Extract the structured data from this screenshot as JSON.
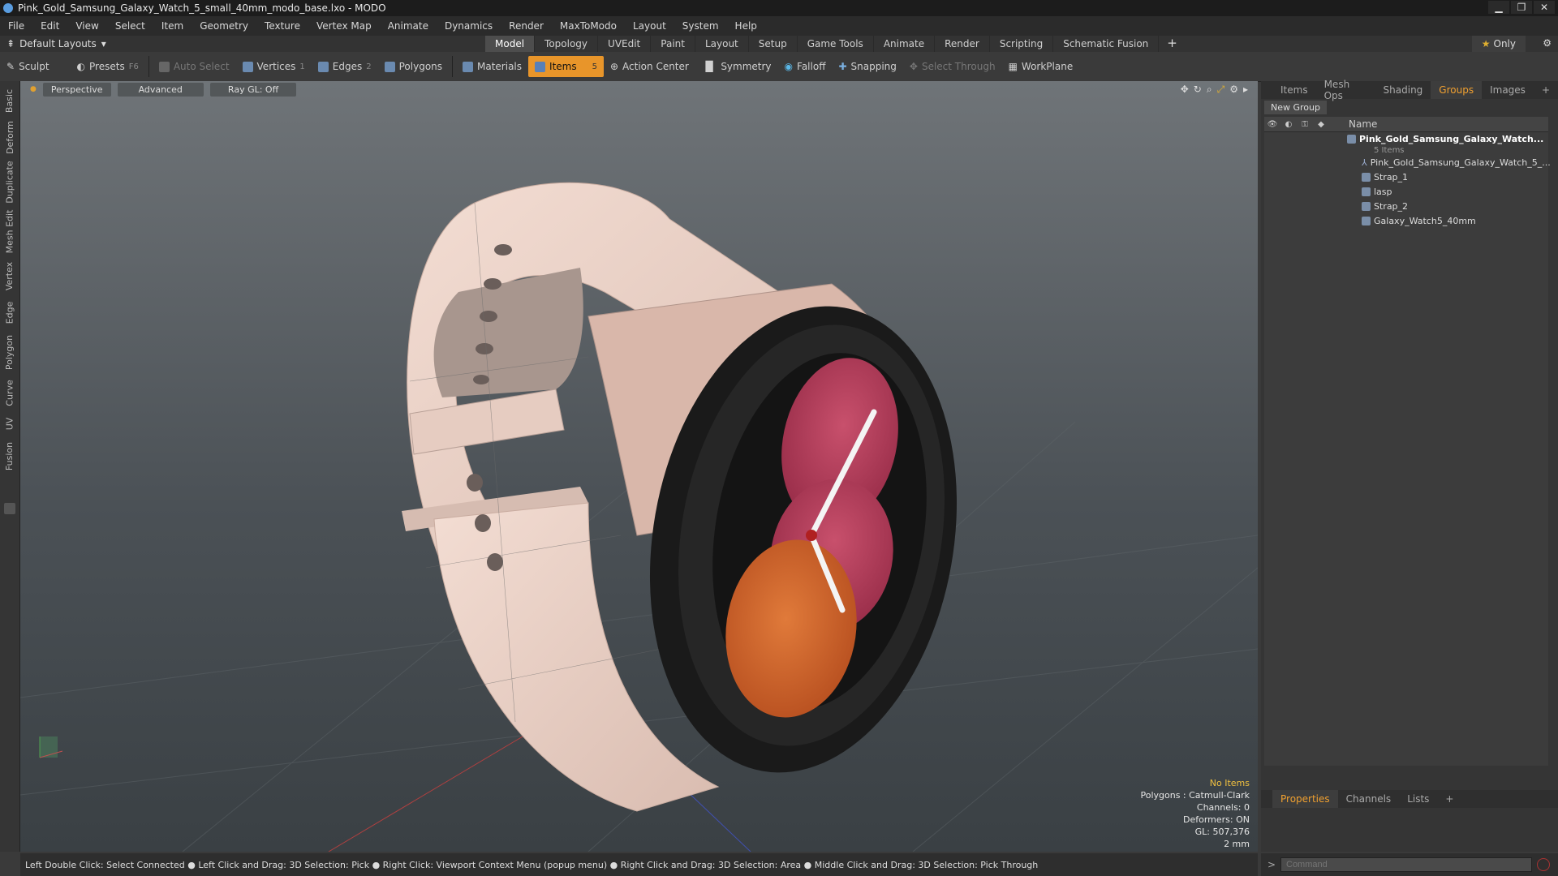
{
  "window": {
    "title": "Pink_Gold_Samsung_Galaxy_Watch_5_small_40mm_modo_base.lxo - MODO"
  },
  "menu": [
    "File",
    "Edit",
    "View",
    "Select",
    "Item",
    "Geometry",
    "Texture",
    "Vertex Map",
    "Animate",
    "Dynamics",
    "Render",
    "MaxToModo",
    "Layout",
    "System",
    "Help"
  ],
  "layout": {
    "dropdown": "Default Layouts",
    "tabs": [
      "Model",
      "Topology",
      "UVEdit",
      "Paint",
      "Layout",
      "Setup",
      "Game Tools",
      "Animate",
      "Render",
      "Scripting",
      "Schematic Fusion"
    ],
    "active_tab": "Model",
    "only_label": "Only"
  },
  "toolbar": {
    "sculpt": "Sculpt",
    "presets": "Presets",
    "presets_key": "F6",
    "auto_select": "Auto Select",
    "vertices": "Vertices",
    "vertices_count": "1",
    "edges": "Edges",
    "edges_count": "2",
    "polygons": "Polygons",
    "materials": "Materials",
    "items": "Items",
    "items_count": "5",
    "action_center": "Action Center",
    "symmetry": "Symmetry",
    "falloff": "Falloff",
    "snapping": "Snapping",
    "select_through": "Select Through",
    "workplane": "WorkPlane"
  },
  "left_tabs": [
    "Basic",
    "Deform",
    "Duplicate",
    "Mesh Edit",
    "Vertex",
    "Edge",
    "Polygon",
    "Curve",
    "UV",
    "Fusion"
  ],
  "viewport": {
    "perspective": "Perspective",
    "advanced": "Advanced",
    "raygl": "Ray GL: Off",
    "info": {
      "items": "No Items",
      "polygons": "Polygons : Catmull-Clark",
      "channels": "Channels: 0",
      "deformers": "Deformers: ON",
      "gl": "GL: 507,376",
      "scale": "2 mm"
    }
  },
  "right_panel": {
    "tabs": [
      "Items",
      "Mesh Ops",
      "Shading",
      "Groups",
      "Images"
    ],
    "active_tab": "Groups",
    "new_group": "New Group",
    "name_header": "Name",
    "group_name": "Pink_Gold_Samsung_Galaxy_Watch...",
    "group_count": "5 Items",
    "items": [
      "Pink_Gold_Samsung_Galaxy_Watch_5_...",
      "Strap_1",
      "lasp",
      "Strap_2",
      "Galaxy_Watch5_40mm"
    ]
  },
  "properties": {
    "tabs": [
      "Properties",
      "Channels",
      "Lists"
    ],
    "active": "Properties"
  },
  "command": {
    "placeholder": "Command"
  },
  "status": "Left Double Click: Select Connected ● Left Click and Drag: 3D Selection: Pick ● Right Click: Viewport Context Menu (popup menu) ● Right Click and Drag: 3D Selection: Area ● Middle Click and Drag: 3D Selection: Pick Through",
  "colors": {
    "accent": "#e8952a",
    "active_tab_text": "#f0a030",
    "strap": "#ecd3c8",
    "case": "#d4b2a6",
    "bezel": "#1e1e1e",
    "face_pink": "#b8405e",
    "face_orange": "#d56a30"
  }
}
